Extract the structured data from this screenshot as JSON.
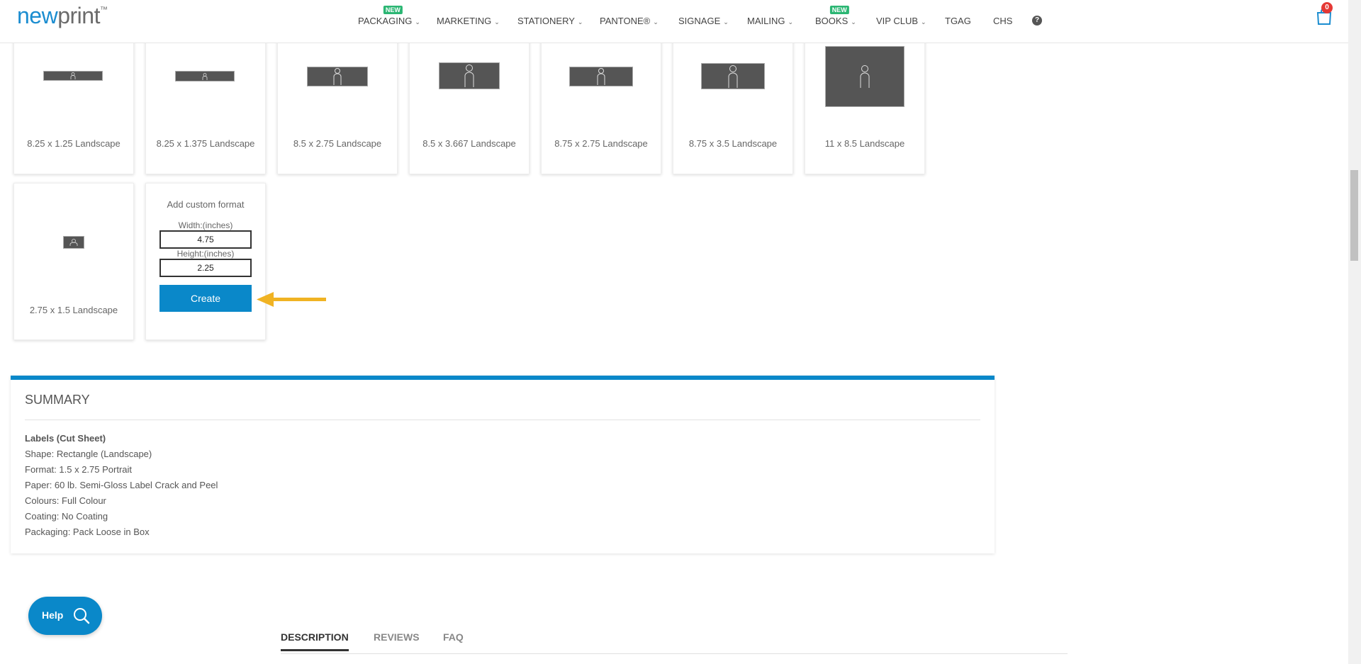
{
  "header": {
    "logo": {
      "part1": "new",
      "part2": "print",
      "tm": "™"
    },
    "nav": [
      {
        "label": "PACKAGING",
        "badge": "NEW",
        "dropdown": true
      },
      {
        "label": "MARKETING",
        "dropdown": true
      },
      {
        "label": "STATIONERY",
        "dropdown": true
      },
      {
        "label": "PANTONE®",
        "dropdown": true
      },
      {
        "label": "SIGNAGE",
        "dropdown": true
      },
      {
        "label": "MAILING",
        "dropdown": true
      },
      {
        "label": "BOOKS",
        "badge": "NEW",
        "dropdown": true
      },
      {
        "label": "VIP CLUB",
        "dropdown": true
      },
      {
        "label": "TGAG",
        "dropdown": false
      },
      {
        "label": "CHS",
        "dropdown": false
      }
    ],
    "help_icon": "question-circle-icon",
    "cart": {
      "icon": "shopping-bag-icon",
      "count": "0"
    }
  },
  "formats": [
    {
      "label": "8.25 x 1.25 Landscape"
    },
    {
      "label": "8.25 x 1.375 Landscape"
    },
    {
      "label": "8.5 x 2.75 Landscape"
    },
    {
      "label": "8.5 x 3.667 Landscape"
    },
    {
      "label": "8.75 x 2.75 Landscape"
    },
    {
      "label": "8.75 x 3.5 Landscape"
    },
    {
      "label": "11 x 8.5 Landscape"
    },
    {
      "label": "2.75 x 1.5 Landscape"
    }
  ],
  "custom_format": {
    "title": "Add custom format",
    "width_label": "Width:(inches)",
    "width_value": "4.75",
    "height_label": "Height:(inches)",
    "height_value": "2.25",
    "create_label": "Create"
  },
  "summary": {
    "title": "SUMMARY",
    "product": "Labels (Cut Sheet)",
    "lines": [
      "Shape: Rectangle (Landscape)",
      "Format: 1.5 x 2.75 Portrait",
      "Paper: 60 lb. Semi-Gloss Label Crack and Peel",
      "Colours: Full Colour",
      "Coating: No Coating",
      "Packaging: Pack Loose in Box"
    ]
  },
  "help_button": {
    "label": "Help"
  },
  "tabs": [
    {
      "label": "DESCRIPTION",
      "active": true
    },
    {
      "label": "REVIEWS",
      "active": false
    },
    {
      "label": "FAQ",
      "active": false
    }
  ],
  "colors": {
    "accent": "#0a88c9",
    "badge_green": "#2bb673",
    "arrow": "#f0b323",
    "cart_badge": "#e53935"
  }
}
